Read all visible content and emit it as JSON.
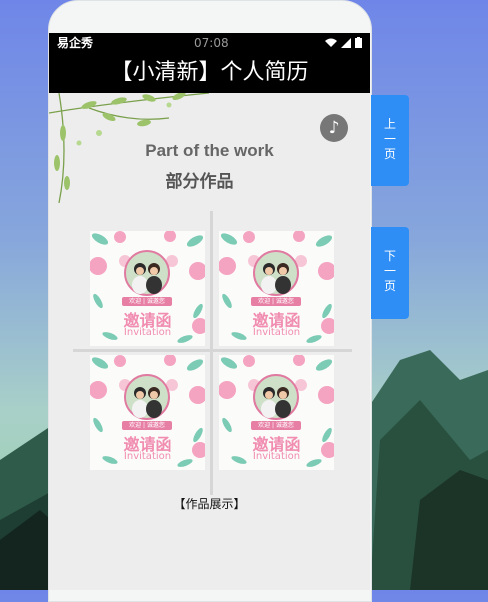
{
  "status_bar": {
    "carrier": "易企秀",
    "time": "07:08"
  },
  "page": {
    "title": "【小清新】个人简历"
  },
  "section": {
    "heading_en": "Part of the work",
    "heading_cn": "部分作品"
  },
  "gallery": {
    "items": [
      {
        "banner": "欢迎 | 诚邀您",
        "title": "邀请函",
        "subtitle": "Invitation"
      },
      {
        "banner": "欢迎 | 诚邀您",
        "title": "邀请函",
        "subtitle": "Invitation"
      },
      {
        "banner": "欢迎 | 诚邀您",
        "title": "邀请函",
        "subtitle": "Invitation"
      },
      {
        "banner": "欢迎 | 诚邀您",
        "title": "邀请函",
        "subtitle": "Invitation"
      }
    ],
    "caption": "【作品展示】"
  },
  "nav": {
    "prev": [
      "上",
      "一",
      "页"
    ],
    "next": [
      "下",
      "一",
      "页"
    ]
  },
  "music_icon": "music-note-icon",
  "colors": {
    "accent_blue": "#2e8ef5",
    "title_bar": "#000000",
    "screen_bg": "#ededed"
  }
}
